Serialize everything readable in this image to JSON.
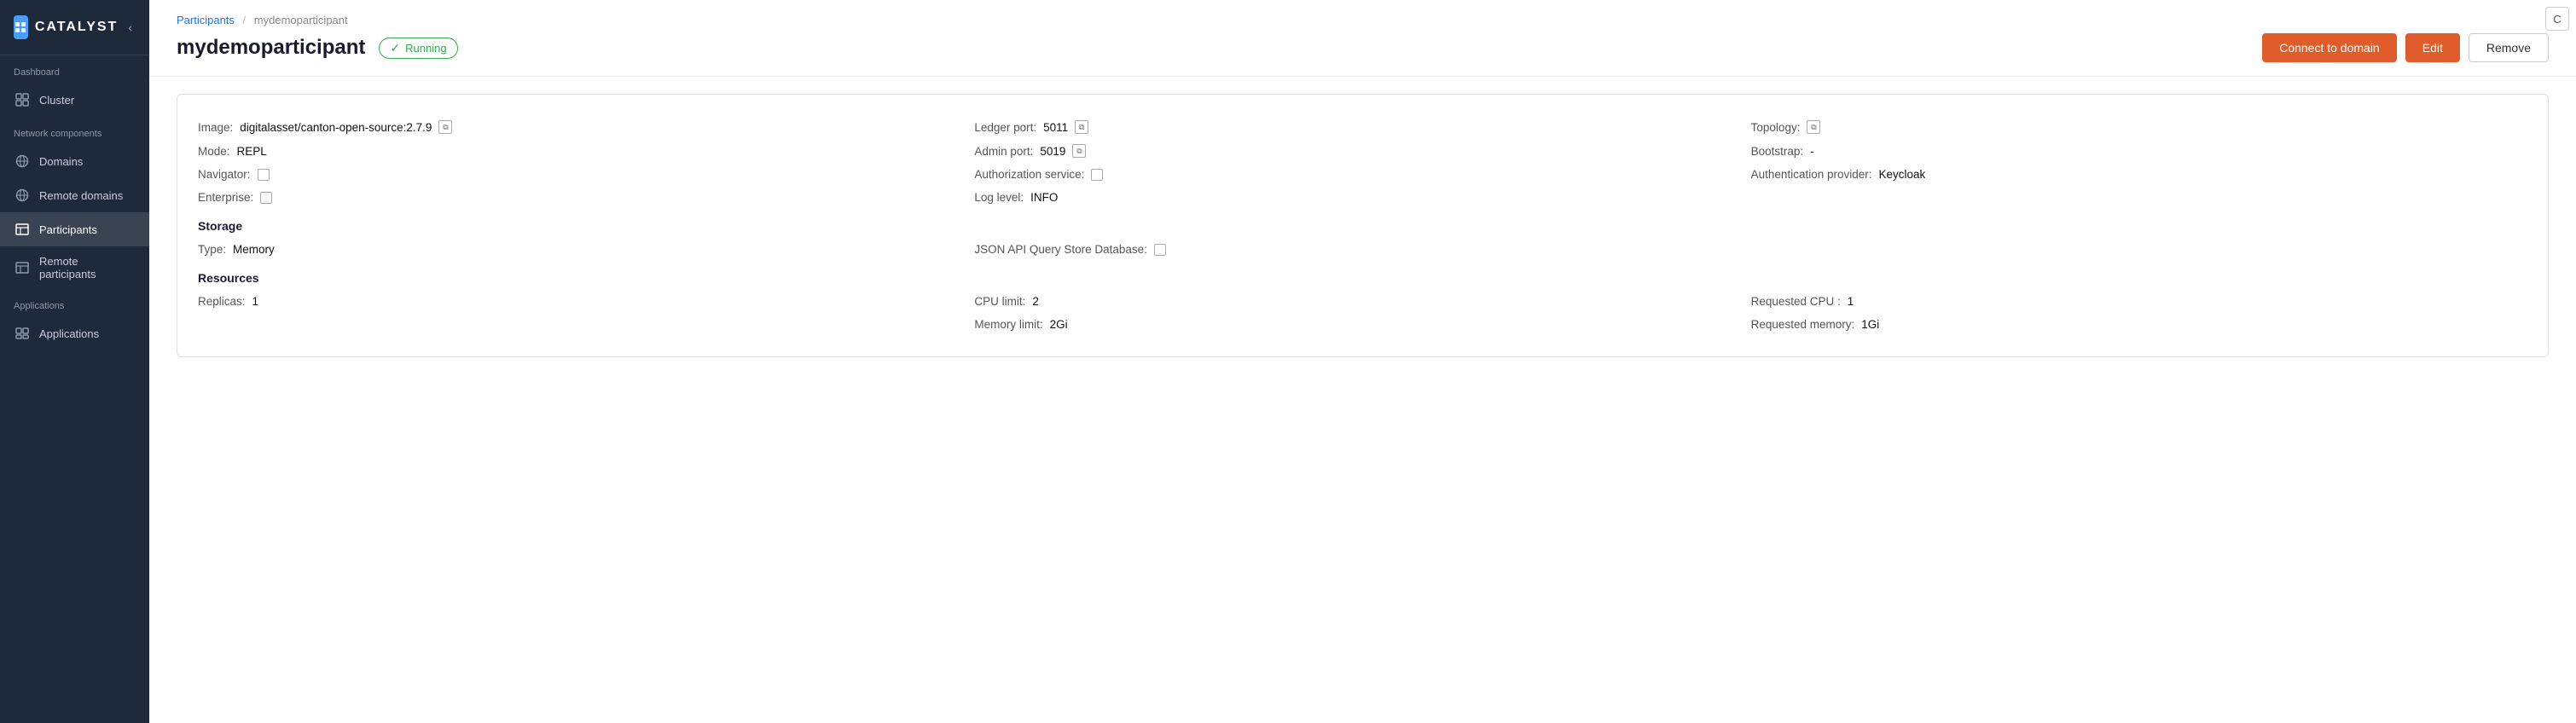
{
  "sidebar": {
    "logo": "CATALYST",
    "logo_icon": "C",
    "sections": {
      "dashboard_label": "Dashboard",
      "cluster_label": "Cluster",
      "network_label": "Network components",
      "applications_label": "Applications"
    },
    "items": [
      {
        "id": "cluster",
        "label": "Cluster",
        "icon": "grid"
      },
      {
        "id": "domains",
        "label": "Domains",
        "icon": "globe"
      },
      {
        "id": "remote-domains",
        "label": "Remote domains",
        "icon": "globe-2"
      },
      {
        "id": "participants",
        "label": "Participants",
        "icon": "table",
        "active": true
      },
      {
        "id": "remote-participants",
        "label": "Remote participants",
        "icon": "table-2"
      },
      {
        "id": "applications",
        "label": "Applications",
        "icon": "app"
      }
    ]
  },
  "breadcrumb": {
    "parent": "Participants",
    "current": "mydemoparticipant"
  },
  "page": {
    "title": "mydemoparticipant",
    "status": "Running"
  },
  "actions": {
    "connect_label": "Connect to domain",
    "edit_label": "Edit",
    "remove_label": "Remove"
  },
  "detail": {
    "image_label": "Image:",
    "image_value": "digitalasset/canton-open-source:2.7.9",
    "ledger_port_label": "Ledger port:",
    "ledger_port_value": "5011",
    "topology_label": "Topology:",
    "mode_label": "Mode:",
    "mode_value": "REPL",
    "admin_port_label": "Admin port:",
    "admin_port_value": "5019",
    "bootstrap_label": "Bootstrap:",
    "bootstrap_value": "-",
    "navigator_label": "Navigator:",
    "auth_service_label": "Authorization service:",
    "auth_provider_label": "Authentication provider:",
    "auth_provider_value": "Keycloak",
    "enterprise_label": "Enterprise:",
    "log_level_label": "Log level:",
    "log_level_value": "INFO",
    "storage_heading": "Storage",
    "type_label": "Type:",
    "type_value": "Memory",
    "json_api_label": "JSON API Query Store Database:",
    "resources_heading": "Resources",
    "replicas_label": "Replicas:",
    "replicas_value": "1",
    "cpu_limit_label": "CPU limit:",
    "cpu_limit_value": "2",
    "req_cpu_label": "Requested CPU :",
    "req_cpu_value": "1",
    "memory_limit_label": "Memory limit:",
    "memory_limit_value": "2Gi",
    "req_memory_label": "Requested memory:",
    "req_memory_value": "1Gi"
  },
  "window_btn": "C"
}
